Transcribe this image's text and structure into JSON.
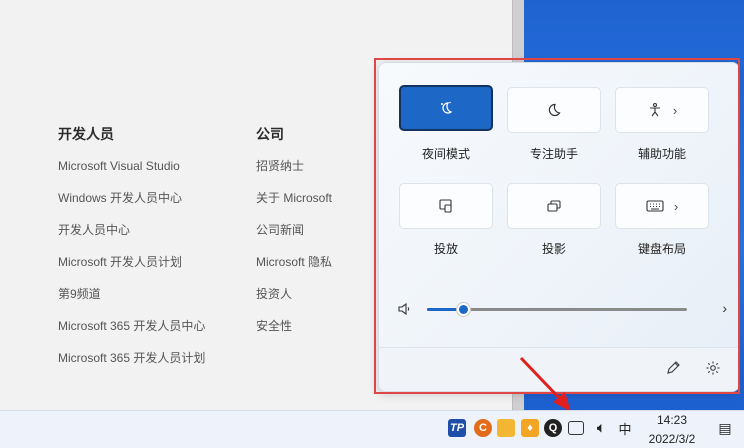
{
  "footer_links": {
    "developers": {
      "title": "开发人员",
      "items": [
        "Microsoft Visual Studio",
        "Windows 开发人员中心",
        "开发人员中心",
        "Microsoft 开发人员计划",
        "第9频道",
        "Microsoft 365 开发人员中心",
        "Microsoft 365 开发人员计划"
      ]
    },
    "company": {
      "title": "公司",
      "items": [
        "招贤纳士",
        "关于 Microsoft",
        "公司新闻",
        "Microsoft 隐私",
        "投资人",
        "安全性"
      ]
    }
  },
  "quick_settings": {
    "tiles": [
      {
        "label": "夜间模式",
        "icon": "night-light-icon",
        "active": true
      },
      {
        "label": "专注助手",
        "icon": "moon-icon",
        "active": false
      },
      {
        "label": "辅助功能",
        "icon": "accessibility-icon",
        "active": false,
        "has_more": true
      },
      {
        "label": "投放",
        "icon": "cast-icon",
        "active": false
      },
      {
        "label": "投影",
        "icon": "project-icon",
        "active": false
      },
      {
        "label": "键盘布局",
        "icon": "keyboard-icon",
        "active": false,
        "has_more": true
      }
    ],
    "volume": {
      "level_percent": 14,
      "icon": "speaker-icon"
    },
    "footer_icons": [
      "edit-icon",
      "settings-icon"
    ]
  },
  "taskbar": {
    "tray_icons": [
      "tp-icon",
      "c-icon",
      "folder-icon",
      "flame-icon",
      "qq-icon",
      "network-icon",
      "volume-icon",
      "ime-icon"
    ],
    "ime_label": "中",
    "time": "14:23",
    "date": "2022/3/2"
  },
  "colors": {
    "accent": "#1d67c6",
    "annotation": "#e04646",
    "desktop": "#2b79e8"
  }
}
